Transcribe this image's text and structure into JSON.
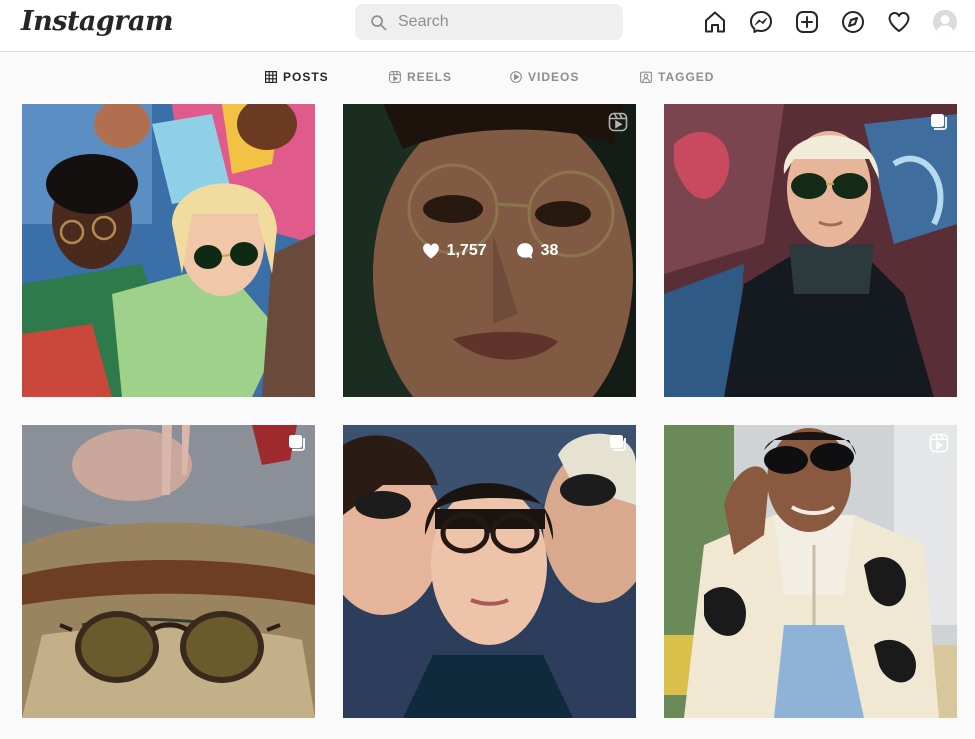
{
  "header": {
    "logo": "Instagram",
    "search_placeholder": "Search",
    "nav": [
      "home-icon",
      "messenger-icon",
      "new-post-icon",
      "explore-icon",
      "activity-heart-icon",
      "profile-avatar"
    ]
  },
  "tabs": [
    {
      "label": "POSTS",
      "icon": "grid-icon",
      "active": true
    },
    {
      "label": "REELS",
      "icon": "reels-icon",
      "active": false
    },
    {
      "label": "VIDEOS",
      "icon": "video-icon",
      "active": false
    },
    {
      "label": "TAGGED",
      "icon": "tagged-icon",
      "active": false
    }
  ],
  "posts": [
    {
      "type": "photo",
      "badge": "",
      "scene": "group of friends with round sunglasses"
    },
    {
      "type": "reel",
      "badge": "reels-icon",
      "likes": "1,757",
      "comments": "38",
      "hover": true
    },
    {
      "type": "carousel",
      "badge": "carousel-icon"
    },
    {
      "type": "carousel",
      "badge": "carousel-icon"
    },
    {
      "type": "carousel",
      "badge": "carousel-icon"
    },
    {
      "type": "reel",
      "badge": "reels-icon"
    }
  ],
  "colors": {
    "text": "#262626",
    "muted": "#8e8e8e",
    "border": "#dbdbdb",
    "search_bg": "#efefef",
    "page_bg": "#fafafa"
  }
}
